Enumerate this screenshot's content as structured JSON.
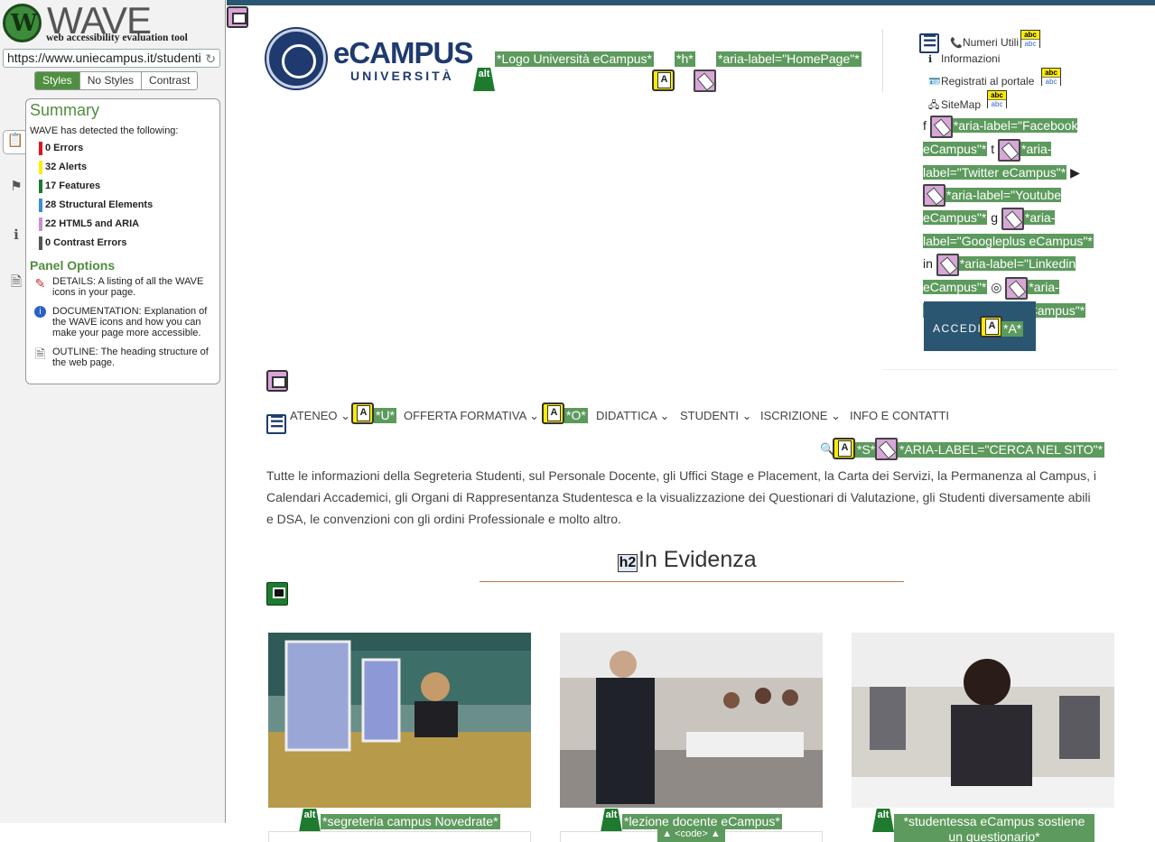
{
  "wave": {
    "logo_word": "WAVE",
    "logo_tagline": "web accessibility evaluation tool",
    "url": "https://www.uniecampus.it/studenti",
    "tabs": [
      "Styles",
      "No Styles",
      "Contrast"
    ],
    "active_tab": "Styles",
    "summary_title": "Summary",
    "detected_text": "WAVE has detected the following:",
    "summary": [
      {
        "label": "0 Errors",
        "color": "#e0141e"
      },
      {
        "label": "32 Alerts",
        "color": "#ffee00"
      },
      {
        "label": "17 Features",
        "color": "#1e7a2e"
      },
      {
        "label": "28 Structural Elements",
        "color": "#3a8fd6"
      },
      {
        "label": "22 HTML5 and ARIA",
        "color": "#c98fd1"
      },
      {
        "label": "0 Contrast Errors",
        "color": "#555555"
      }
    ],
    "panel_options_title": "Panel Options",
    "options": [
      {
        "icon": "details-icon",
        "text": "DETAILS: A listing of all the WAVE icons in your page."
      },
      {
        "icon": "documentation-icon",
        "text": "DOCUMENTATION: Explanation of the WAVE icons and how you can make your page more accessible."
      },
      {
        "icon": "outline-icon",
        "text": "OUTLINE: The heading structure of the web page."
      }
    ]
  },
  "site": {
    "logo_main": "eCAMPUS",
    "logo_sub": "UNIVERSITÀ",
    "logo_alt_label": "*Logo Università eCampus*",
    "logo_h_label": "*h*",
    "logo_aria_label": "*aria-label=\"HomePage\"*",
    "util_links": [
      "Numeri Utili",
      "Informazioni",
      "Registrati al portale",
      "SiteMap"
    ],
    "social_labels": [
      "*aria-label=\"Facebook eCampus\"*",
      "*aria-label=\"Twitter eCampus\"*",
      "*aria-label=\"Youtube eCampus\"*",
      "*aria-label=\"Googleplus eCampus\"*",
      "*aria-label=\"Linkedin eCampus\"*",
      "*aria-label=\"Instagram eCampus\"*"
    ],
    "accedi_label": "ACCEDI",
    "accedi_key": "*A*",
    "menu": [
      "ATENEO",
      "OFFERTA FORMATIVA",
      "DIDATTICA",
      "STUDENTI",
      "ISCRIZIONE",
      "INFO E CONTATTI"
    ],
    "menu_keys": [
      "*U*",
      "*O*"
    ],
    "search_key": "*S*",
    "search_aria": "*ARIA-LABEL=\"CERCA NEL SITO\"*",
    "intro": "Tutte le informazioni della Segreteria Studenti, sul Personale Docente, gli Uffici Stage e Placement, la Carta dei Servizi, la Permanenza al Campus, i Calendari Accademici, gli Organi di Rappresentanza Studentesca e la visualizzazione dei Questionari di Valutazione, gli Studenti diversamente abili e DSA, le convenzioni con gli ordini Professionale e molto altro.",
    "section_title": "In Evidenza",
    "cards": [
      {
        "alt": "*segreteria campus Novedrate*"
      },
      {
        "alt": "*lezione docente eCampus*"
      },
      {
        "alt": "*studentessa eCampus sostiene un questionario*"
      }
    ],
    "code_tab": "▲ <code> ▲"
  }
}
